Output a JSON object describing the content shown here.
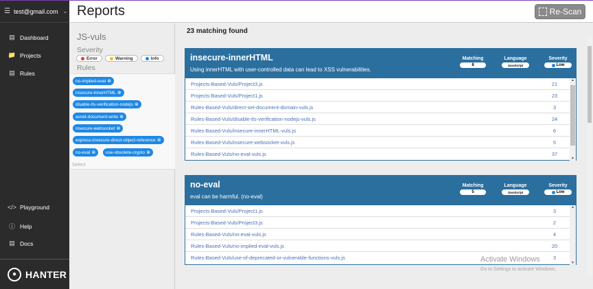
{
  "account": {
    "email": "test@gmail.com"
  },
  "nav": [
    {
      "label": "Dashboard",
      "icon": "dashboard-icon"
    },
    {
      "label": "Projects",
      "icon": "folder-icon"
    },
    {
      "label": "Rules",
      "icon": "clipboard-icon"
    },
    {
      "label": "Playground",
      "icon": "code-icon"
    },
    {
      "label": "Help",
      "icon": "help-icon"
    },
    {
      "label": "Docs",
      "icon": "docs-icon"
    }
  ],
  "brand": {
    "name": "HANTER"
  },
  "header": {
    "title": "Reports",
    "rescan_label": "Re-Scan"
  },
  "filter": {
    "project": "JS-vuls",
    "severity_label": "Severity",
    "severities": [
      {
        "label": "Error",
        "color": "#e53935"
      },
      {
        "label": "Warning",
        "color": "#f4c20d"
      },
      {
        "label": "Info",
        "color": "#1e88e5"
      }
    ],
    "rules_label": "Rules",
    "rules": [
      "no-implied-eval",
      "insecure-innerHTML",
      "disable-tls-verification-nodejs",
      "avoid-document-write",
      "insecure-websocket",
      "express-insecure-direct-object-reference",
      "no-eval",
      "use-obsolete-crypto"
    ],
    "select_placeholder": "Select"
  },
  "results": {
    "summary": "23 matching found",
    "meta_labels": {
      "matching": "Matching",
      "language": "Language",
      "severity": "Severity"
    },
    "cards": [
      {
        "title": "insecure-innerHTML",
        "description": "Using innerHTML with user-controlled data can lead to XSS vulnerabilities.",
        "matching": "8",
        "language": "JavaScript",
        "severity": "Low",
        "rows": [
          {
            "path": "Projects-Based-Vuls/Project3.js",
            "line": "21"
          },
          {
            "path": "Projects-Based-Vuls/Project1.js",
            "line": "23"
          },
          {
            "path": "Rules-Based-Vuls/direct-set-document-domain-vuls.js",
            "line": "3"
          },
          {
            "path": "Rules-Based-Vuls/disable-tls-verification-nodejs-vuls.js",
            "line": "24"
          },
          {
            "path": "Rules-Based-Vuls/insecure-innerHTML-vuls.js",
            "line": "6"
          },
          {
            "path": "Rules-Based-Vuls/insecure-websocket-vuls.js",
            "line": "5"
          },
          {
            "path": "Rules-Based-Vuls/no-eval-vuls.js",
            "line": "37"
          }
        ]
      },
      {
        "title": "no-eval",
        "description": "eval can be harmful. (no-eval)",
        "matching": "5",
        "language": "JavaScript",
        "severity": "Low",
        "rows": [
          {
            "path": "Projects-Based-Vuls/Project1.js",
            "line": "3"
          },
          {
            "path": "Projects-Based-Vuls/Project3.js",
            "line": "2"
          },
          {
            "path": "Rules-Based-Vuls/no-eval-vuls.js",
            "line": "4"
          },
          {
            "path": "Rules-Based-Vuls/no-implied-eval-vuls.js",
            "line": "20"
          },
          {
            "path": "Rules-Based-Vuls/use-of-deprecated-or-vulnerable-functions-vuls.js",
            "line": "3"
          }
        ]
      }
    ]
  },
  "watermark": {
    "title": "Activate Windows",
    "subtitle": "Go to Settings to activate Windows."
  },
  "colors": {
    "accent": "#2b6f9f",
    "chip": "#1e88e5",
    "sidebar": "#2b2b2b"
  }
}
